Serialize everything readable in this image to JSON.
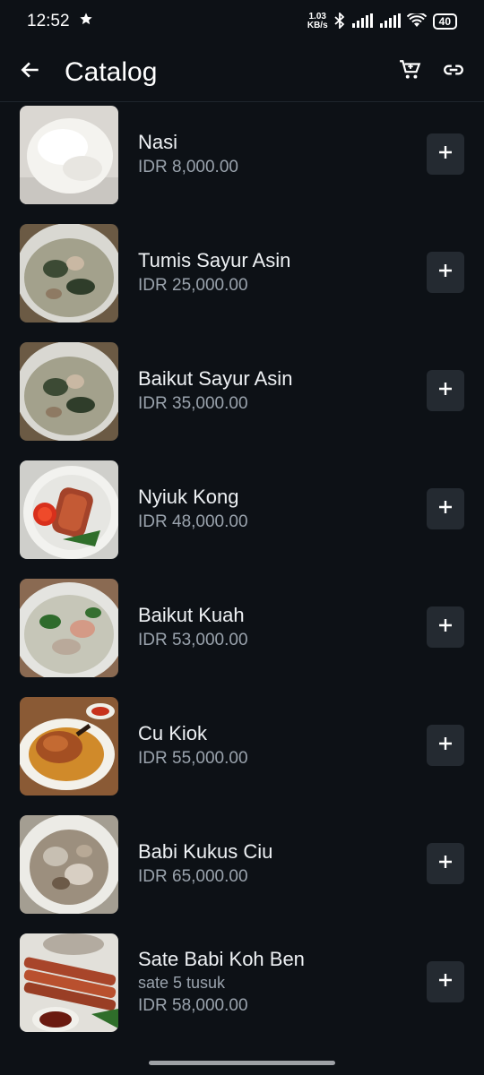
{
  "status": {
    "time": "12:52",
    "net_speed_value": "1.03",
    "net_speed_unit": "KB/s",
    "battery": "40"
  },
  "appbar": {
    "title": "Catalog",
    "back_icon": "arrow-back-icon",
    "cart_icon": "cart-icon",
    "link_icon": "link-icon"
  },
  "items": [
    {
      "name": "Nasi",
      "description": "",
      "price": "IDR 8,000.00",
      "image": "white rice mound"
    },
    {
      "name": "Tumis Sayur Asin",
      "description": "",
      "price": "IDR 25,000.00",
      "image": "salted vegetable soup bowl"
    },
    {
      "name": "Baikut Sayur Asin",
      "description": "",
      "price": "IDR 35,000.00",
      "image": "salted vegetable soup bowl"
    },
    {
      "name": "Nyiuk Kong",
      "description": "",
      "price": "IDR 48,000.00",
      "image": "fried rolls with chili sauce"
    },
    {
      "name": "Baikut Kuah",
      "description": "",
      "price": "IDR 53,000.00",
      "image": "pork rib soup with greens"
    },
    {
      "name": "Cu Kiok",
      "description": "",
      "price": "IDR 55,000.00",
      "image": "braised pork trotter with star anise"
    },
    {
      "name": "Babi Kukus Ciu",
      "description": "",
      "price": "IDR 65,000.00",
      "image": "steamed pork in broth"
    },
    {
      "name": "Sate Babi Koh Ben",
      "description": "sate 5 tusuk",
      "price": "IDR 58,000.00",
      "image": "pork satay skewers with sauce"
    }
  ],
  "colors": {
    "background": "#0d1116",
    "button_bg": "#242a31",
    "price_text": "#9aa3ad"
  }
}
